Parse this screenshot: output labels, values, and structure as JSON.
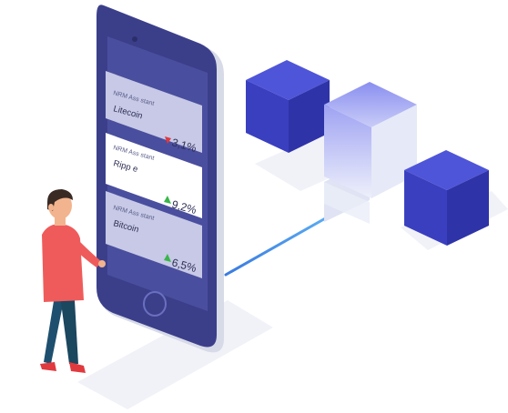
{
  "cards": [
    {
      "label": "NRM Ass stant",
      "coin": "Litecoin",
      "trend": "down",
      "change": "3,1%"
    },
    {
      "label": "NRM Ass stant",
      "coin": "Ripp e",
      "trend": "up",
      "change": "9,2%"
    },
    {
      "label": "NRM Ass stant",
      "coin": "Bitcoin",
      "trend": "up",
      "change": "6,5%"
    }
  ],
  "colors": {
    "phone_body": "#3b3f8a",
    "screen": "#4a4e9e",
    "card_light": "#ffffff",
    "card_muted": "#c7c9e6",
    "up": "#39b54a",
    "down": "#e0393e",
    "cube_dark": "#3f44c6",
    "link_line": "#3b8fe8",
    "shirt": "#ef5b5b",
    "pants": "#1e4f6e"
  },
  "icons": [
    "trend-down-icon",
    "trend-up-icon",
    "home-button-icon"
  ]
}
